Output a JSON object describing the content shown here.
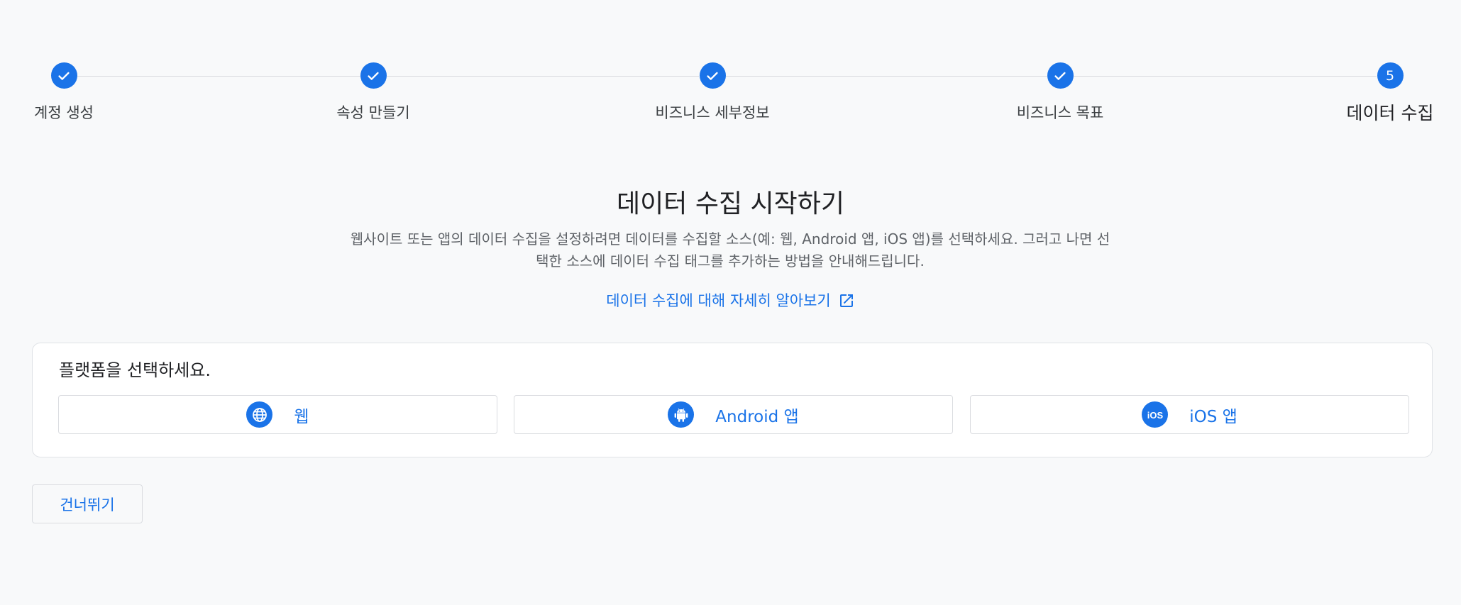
{
  "stepper": {
    "steps": [
      {
        "label": "계정 생성",
        "state": "done"
      },
      {
        "label": "속성 만들기",
        "state": "done"
      },
      {
        "label": "비즈니스 세부정보",
        "state": "done"
      },
      {
        "label": "비즈니스 목표",
        "state": "done"
      },
      {
        "label": "데이터 수집",
        "state": "active",
        "number": "5"
      }
    ]
  },
  "main": {
    "title": "데이터 수집 시작하기",
    "description_line1": "웹사이트 또는 앱의 데이터 수집을 설정하려면 데이터를 수집할 소스(예: 웹, Android 앱, iOS 앱)를 선택하세요. 그러고 나면 선",
    "description_line2": "택한 소스에 데이터 수집 태그를 추가하는 방법을 안내해드립니다.",
    "learn_more_link": "데이터 수집에 대해 자세히 알아보기"
  },
  "platform_card": {
    "title": "플랫폼을 선택하세요.",
    "options": [
      {
        "label": "웹",
        "icon": "globe-icon"
      },
      {
        "label": "Android 앱",
        "icon": "android-icon"
      },
      {
        "label": "iOS 앱",
        "icon": "ios-icon"
      }
    ]
  },
  "skip_button": "건너뛰기",
  "colors": {
    "accent": "#1a73e8",
    "background": "#f8f9fa",
    "text": "#202124",
    "muted": "#5f6368"
  }
}
